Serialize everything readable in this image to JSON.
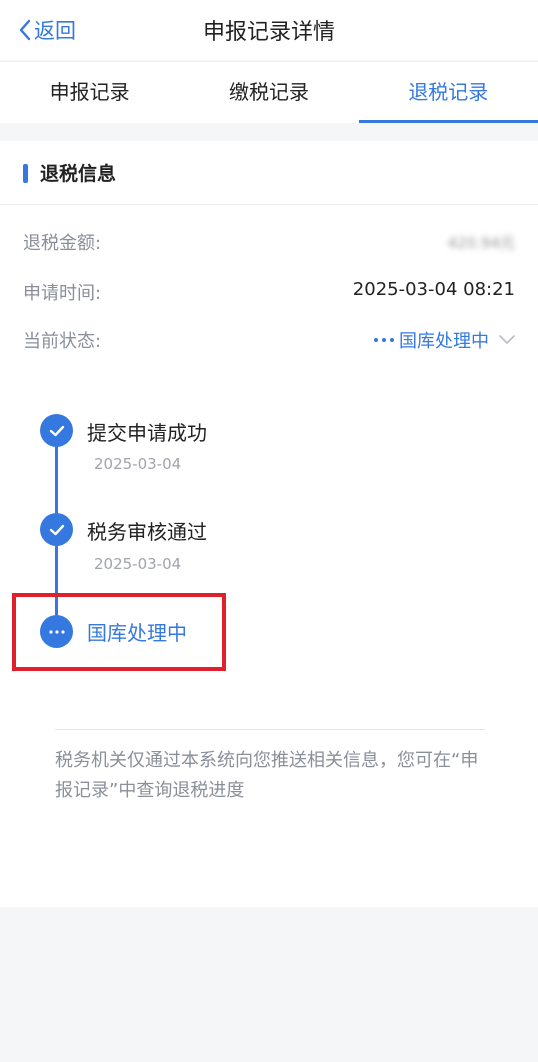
{
  "nav": {
    "back_label": "返回",
    "title": "申报记录详情"
  },
  "tabs": [
    {
      "label": "申报记录",
      "active": false
    },
    {
      "label": "缴税记录",
      "active": false
    },
    {
      "label": "退税记录",
      "active": true
    }
  ],
  "section": {
    "title": "退税信息"
  },
  "info": {
    "amount_label": "退税金额:",
    "amount_value": "420.94元",
    "time_label": "申请时间:",
    "time_value": "2025-03-04 08:21",
    "status_label": "当前状态:",
    "status_value": "国库处理中"
  },
  "timeline": [
    {
      "title": "提交申请成功",
      "date": "2025-03-04",
      "state": "done"
    },
    {
      "title": "税务审核通过",
      "date": "2025-03-04",
      "state": "done"
    },
    {
      "title": "国库处理中",
      "date": "",
      "state": "current"
    }
  ],
  "note": "税务机关仅通过本系统向您推送相关信息，您可在“申报记录”中查询退税进度",
  "colors": {
    "accent": "#3478e0",
    "highlight": "#e0202a",
    "background": "#f5f6f8"
  }
}
